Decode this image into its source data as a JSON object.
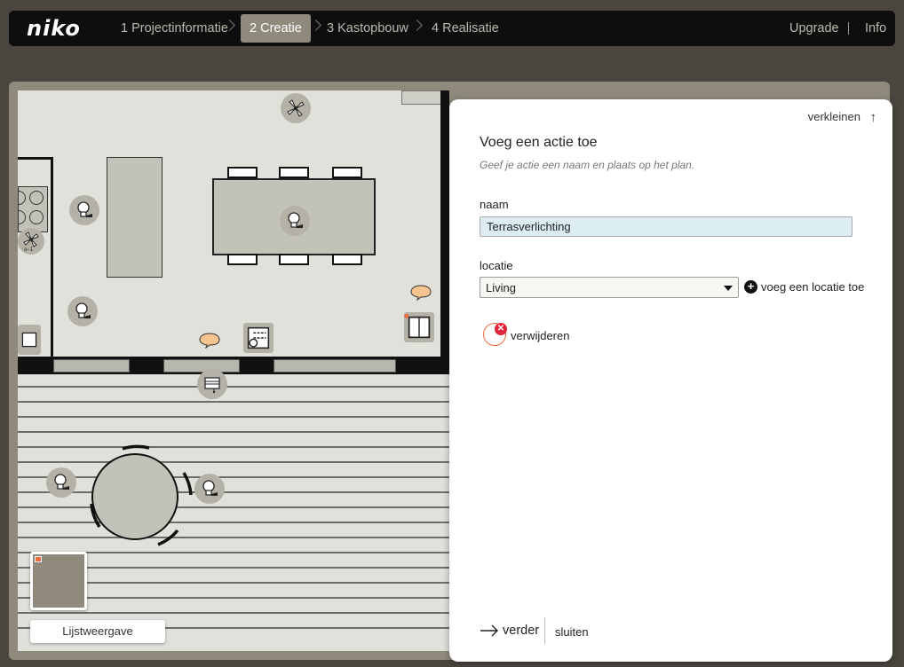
{
  "app": {
    "logo": "niko"
  },
  "nav": {
    "steps": [
      {
        "label": "1 Projectinformatie",
        "active": false
      },
      {
        "label": "2 Creatie",
        "active": true
      },
      {
        "label": "3 Kastopbouw",
        "active": false
      },
      {
        "label": "4 Realisatie",
        "active": false
      }
    ],
    "upgrade_label": "Upgrade",
    "info_label": "Info"
  },
  "plan": {
    "list_view_label": "Lijstweergave",
    "devices": [
      "fan-icon",
      "bulb-icon",
      "speech-bubble-icon",
      "shutter-icon",
      "sunblind-icon",
      "socket-icon"
    ]
  },
  "panel": {
    "collapse_label": "verkleinen",
    "title": "Voeg een actie toe",
    "subtitle": "Geef je actie een naam en plaats op het plan.",
    "name_label": "naam",
    "name_value": "Terrasverlichting",
    "location_label": "locatie",
    "location_value": "Living",
    "add_location_label": "voeg een locatie toe",
    "remove_label": "verwijderen",
    "next_label": "verder",
    "close_label": "sluiten"
  },
  "colors": {
    "topbar": "#0e0e0e",
    "active_step": "#8f8a7b",
    "workspace": "#8f8a7b",
    "accent_orange": "#f06a3a",
    "delete_red": "#e0243a",
    "input_bg": "#dbedf3"
  }
}
